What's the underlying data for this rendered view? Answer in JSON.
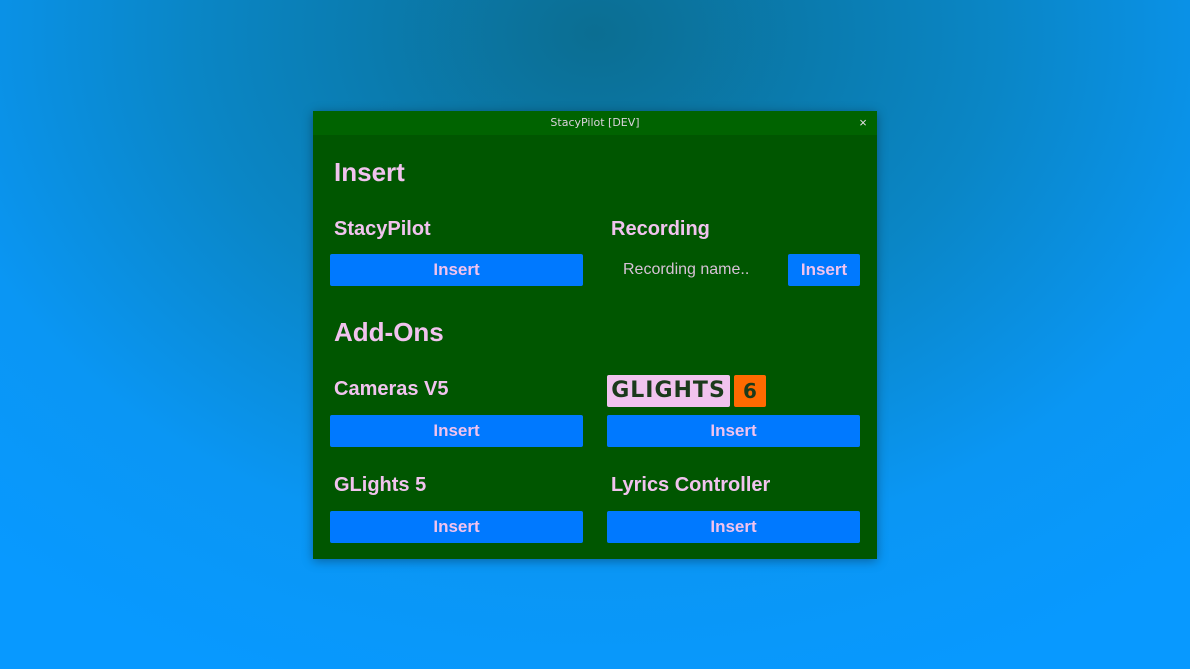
{
  "window": {
    "title": "StacyPilot [DEV]",
    "close_glyph": "×"
  },
  "insert_section": {
    "heading": "Insert",
    "stacypilot": {
      "label": "StacyPilot",
      "button": "Insert"
    },
    "recording": {
      "label": "Recording",
      "placeholder": "Recording name..",
      "button": "Insert"
    }
  },
  "addons_section": {
    "heading": "Add-Ons",
    "cameras": {
      "label": "Cameras V5",
      "button": "Insert"
    },
    "glights6": {
      "logo_text": "GLIGHTS",
      "version_badge": "6",
      "button": "Insert"
    },
    "glights5": {
      "label": "GLights 5",
      "button": "Insert"
    },
    "lyrics": {
      "label": "Lyrics Controller",
      "button": "Insert"
    }
  },
  "colors": {
    "window_bg": "#005600",
    "titlebar_bg": "#006300",
    "button_bg": "#0079ff",
    "text_pink": "#f1c3ee",
    "badge_orange": "#ff6a00"
  }
}
